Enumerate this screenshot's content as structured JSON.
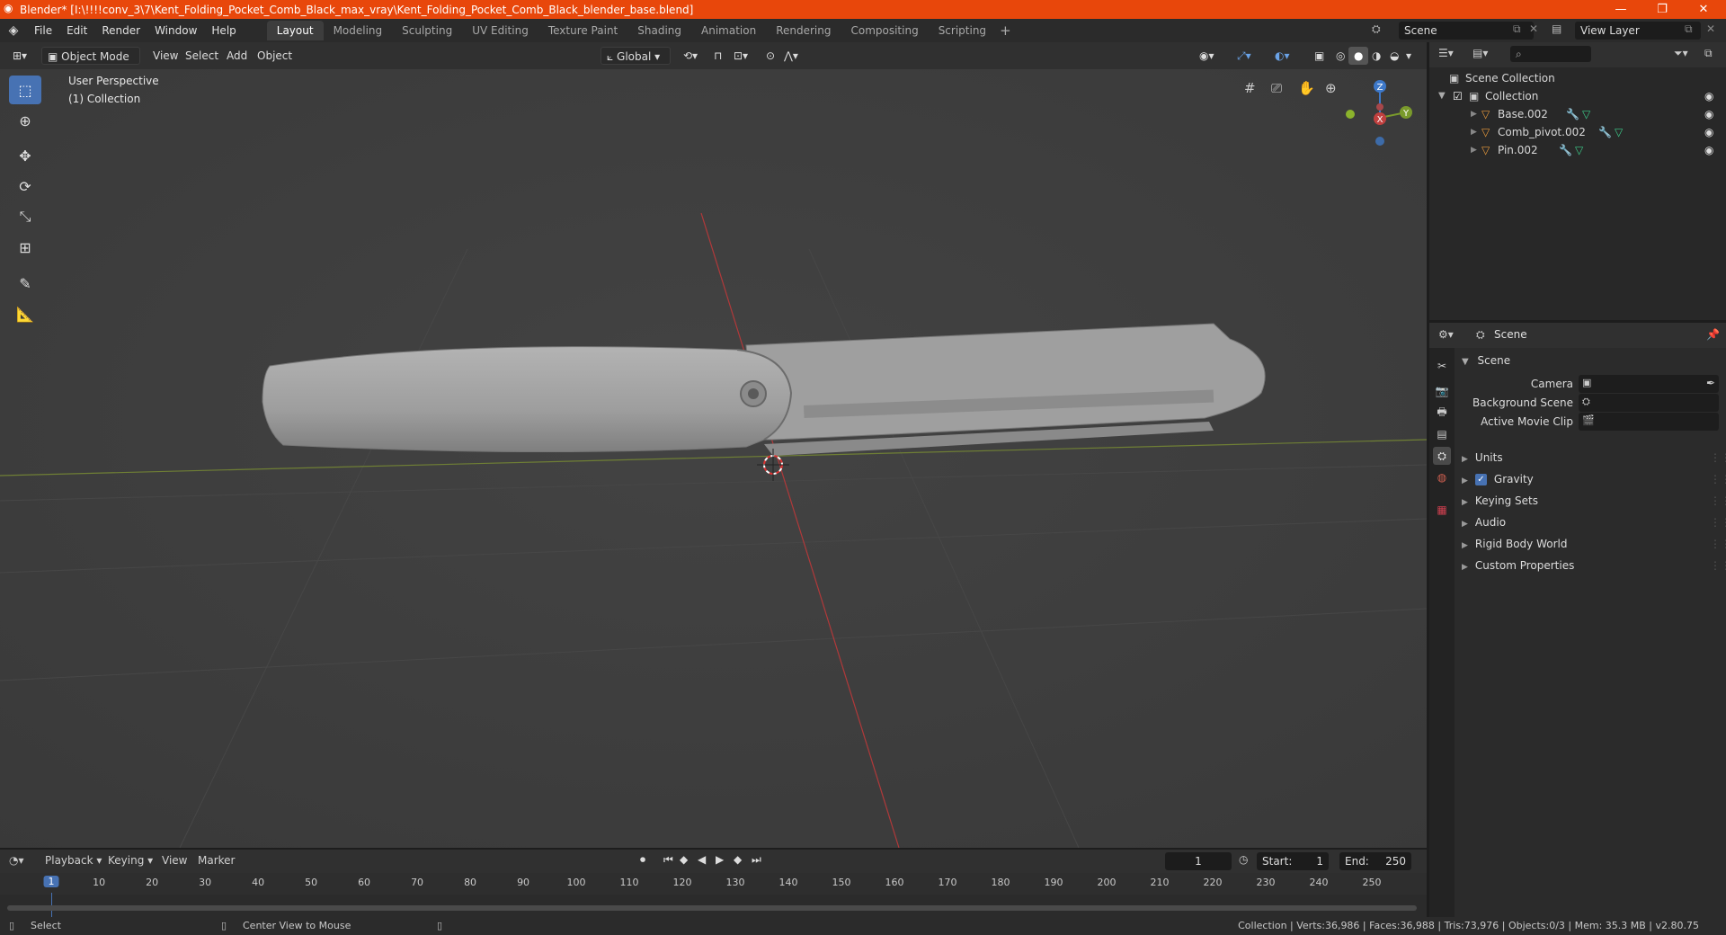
{
  "window": {
    "title": "Blender* [I:\\!!!!conv_3\\7\\Kent_Folding_Pocket_Comb_Black_max_vray\\Kent_Folding_Pocket_Comb_Black_blender_base.blend]",
    "minimize": "—",
    "maximize": "❐",
    "close": "✕"
  },
  "menu": [
    "File",
    "Edit",
    "Render",
    "Window",
    "Help"
  ],
  "workspaces": [
    "Layout",
    "Modeling",
    "Sculpting",
    "UV Editing",
    "Texture Paint",
    "Shading",
    "Animation",
    "Rendering",
    "Compositing",
    "Scripting"
  ],
  "workspace_add": "+",
  "active_workspace": "Layout",
  "scene_field": "Scene",
  "view_layer_field": "View Layer",
  "viewport_header": {
    "mode": "Object Mode",
    "menus": [
      "View",
      "Select",
      "Add",
      "Object"
    ],
    "orientation": "Global"
  },
  "viewport": {
    "perspective_label": "User Perspective",
    "collection_label": "(1) Collection",
    "gizmo": {
      "z": "Z",
      "y": "Y",
      "x": "X"
    }
  },
  "outliner": {
    "root": "Scene Collection",
    "collection": "Collection",
    "objects": [
      "Base.002",
      "Comb_pivot.002",
      "Pin.002"
    ]
  },
  "properties": {
    "header": "Scene",
    "panel_title": "Scene",
    "fields": [
      {
        "label": "Camera",
        "value": ""
      },
      {
        "label": "Background Scene",
        "value": ""
      },
      {
        "label": "Active Movie Clip",
        "value": ""
      }
    ],
    "sections": [
      {
        "label": "Units",
        "checkbox": false
      },
      {
        "label": "Gravity",
        "checkbox": true
      },
      {
        "label": "Keying Sets",
        "checkbox": false
      },
      {
        "label": "Audio",
        "checkbox": false
      },
      {
        "label": "Rigid Body World",
        "checkbox": false
      },
      {
        "label": "Custom Properties",
        "checkbox": false
      }
    ]
  },
  "timeline": {
    "menus": [
      "Playback",
      "Keying",
      "View",
      "Marker"
    ],
    "current_frame": "1",
    "start_label": "Start:",
    "start": "1",
    "end_label": "End:",
    "end": "250",
    "ruler_ticks": [
      "1",
      "10",
      "20",
      "30",
      "40",
      "50",
      "60",
      "70",
      "80",
      "90",
      "100",
      "110",
      "120",
      "130",
      "140",
      "150",
      "160",
      "170",
      "180",
      "190",
      "200",
      "210",
      "220",
      "230",
      "240",
      "250"
    ]
  },
  "statusbar": {
    "left_action": "Select",
    "middle_action": "Center View to Mouse",
    "stats": "Collection | Verts:36,986 | Faces:36,988 | Tris:73,976 | Objects:0/3 | Mem: 35.3 MB | v2.80.75"
  },
  "colors": {
    "titlebar": "#e8470b",
    "active_tool": "#4772b3",
    "axis_x": "#c0403f",
    "axis_y": "#7a9a2c",
    "axis_z": "#3d78c9",
    "comb": "#a0a0a0"
  }
}
